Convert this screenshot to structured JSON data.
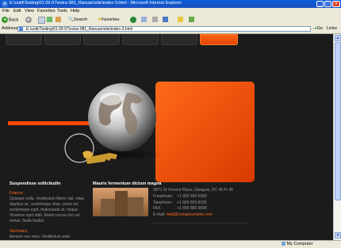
{
  "window": {
    "title": "E:\\untit\\Testing\\01.09.07\\estra-981_Ranuan\\site\\index-3.html - Microsoft Internet Explorer"
  },
  "menu": {
    "items": [
      "File",
      "Edit",
      "View",
      "Favorites",
      "Tools",
      "Help"
    ]
  },
  "toolbar": {
    "back": "Back",
    "search": "Search",
    "favorites": "Favorites"
  },
  "address": {
    "label": "Address",
    "value": "E:\\untit\\Testing\\01.09.07\\estra-981_Ranuan\\site\\index-3.html",
    "go": "Go",
    "links": "Links"
  },
  "status": {
    "zone": "My Computer"
  },
  "page": {
    "left_heading": "Suspendisse sollicitudin",
    "sections": [
      {
        "country": "France",
        "text": "Quisque nulla. Vestibulum libero nisl, vitae, dapibus ac, scelerisque vitae, porta vel, scelerisque eget, malesuada at, neque. Vivamus eget nibh. Etiam cursus leo vel metus. Nulla facilisi."
      },
      {
        "country": "Germany",
        "text": "Aenean nec eros. Vestibulum ante"
      }
    ],
    "center_heading": "Mauris fermentum dictum magna",
    "contact": {
      "address": "9870 St Vincent Place, Glasgow, DC 45 Fr 45",
      "freephone_label": "Freephone:",
      "freephone": "+1 800 559 6580",
      "telephone_label": "Telephone:",
      "telephone": "+1 800 603 6035",
      "fax_label": "FAX:",
      "fax": "+1 800 889 9898",
      "email_label": "E-mail:",
      "email": "mail@companyname.com"
    }
  }
}
